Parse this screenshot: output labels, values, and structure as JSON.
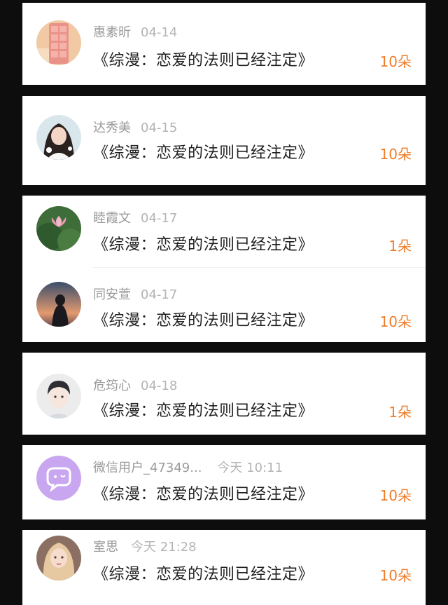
{
  "accent_color": "#f07d2a",
  "entries": [
    {
      "name": "惠素昕",
      "time": "04-14",
      "title": "《综漫：恋爱的法则已经注定》",
      "count": "10朵",
      "avatar": "pink-chocolate-bar-icon"
    },
    {
      "name": "达秀美",
      "time": "04-15",
      "title": "《综漫：恋爱的法则已经注定》",
      "count": "10朵",
      "avatar": "girl-portrait-icon"
    },
    {
      "name": "睦霞文",
      "time": "04-17",
      "title": "《综漫：恋爱的法则已经注定》",
      "count": "1朵",
      "avatar": "lotus-flower-icon"
    },
    {
      "name": "同安萱",
      "time": "04-17",
      "title": "《综漫：恋爱的法则已经注定》",
      "count": "10朵",
      "avatar": "sunset-silhouette-icon"
    },
    {
      "name": "危筠心",
      "time": "04-18",
      "title": "《综漫：恋爱的法则已经注定》",
      "count": "1朵",
      "avatar": "anime-boy-icon"
    },
    {
      "name": "微信用户_47349...",
      "time": "今天 10:11",
      "title": "《综漫：恋爱的法则已经注定》",
      "count": "10朵",
      "avatar": "chat-bubble-icon"
    },
    {
      "name": "室思",
      "time": "今天 21:28",
      "title": "《综漫：恋爱的法则已经注定》",
      "count": "10朵",
      "avatar": "anime-girl-icon"
    }
  ]
}
